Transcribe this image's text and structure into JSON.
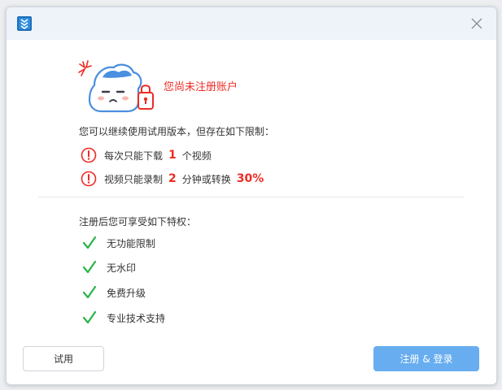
{
  "dialog": {
    "app_icon": "app-logo-icon",
    "close_icon": "close-icon"
  },
  "hero": {
    "illustration": "sad-cloud-with-lock",
    "headline": "您尚未注册账户"
  },
  "limits": {
    "title": "您可以继续使用试用版本，但存在如下限制：",
    "rows": [
      {
        "icon": "warning-icon",
        "text_a": "每次只能下载",
        "value_a": "1",
        "text_b": "个视频"
      },
      {
        "icon": "warning-icon",
        "text_a": "视频只能录制",
        "value_a": "2",
        "text_b": "分钟或转换",
        "value_b": "30%"
      }
    ]
  },
  "perks": {
    "title": "注册后您可享受如下特权：",
    "items": [
      {
        "icon": "check-icon",
        "label": "无功能限制"
      },
      {
        "icon": "check-icon",
        "label": "无水印"
      },
      {
        "icon": "check-icon",
        "label": "免费升级"
      },
      {
        "icon": "check-icon",
        "label": "专业技术支持"
      }
    ]
  },
  "buttons": {
    "trial": "试用",
    "register": "注册 & 登录"
  },
  "colors": {
    "accent_red": "#ee2b24",
    "check_green": "#2bb34a",
    "primary_button": "#67adf0",
    "titlebar": "#eef3f9",
    "cloud_blue": "#4a8fe0"
  }
}
